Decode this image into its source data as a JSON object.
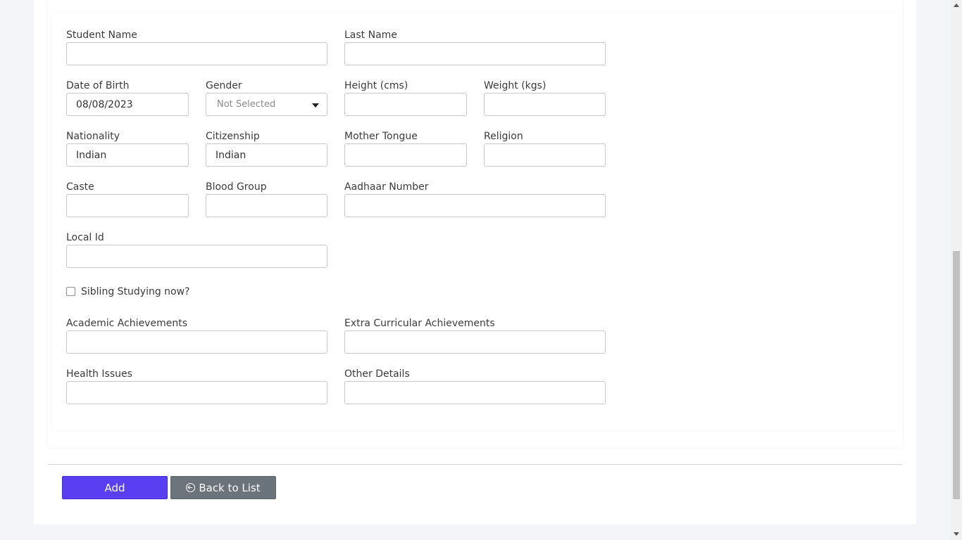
{
  "form": {
    "student_name": {
      "label": "Student Name",
      "value": ""
    },
    "last_name": {
      "label": "Last Name",
      "value": ""
    },
    "date_of_birth": {
      "label": "Date of Birth",
      "value": "08/08/2023"
    },
    "gender": {
      "label": "Gender",
      "selected": "Not Selected"
    },
    "height": {
      "label": "Height (cms)",
      "value": ""
    },
    "weight": {
      "label": "Weight (kgs)",
      "value": ""
    },
    "nationality": {
      "label": "Nationality",
      "value": "Indian"
    },
    "citizenship": {
      "label": "Citizenship",
      "value": "Indian"
    },
    "mother_tongue": {
      "label": "Mother Tongue",
      "value": ""
    },
    "religion": {
      "label": "Religion",
      "value": ""
    },
    "caste": {
      "label": "Caste",
      "value": ""
    },
    "blood_group": {
      "label": "Blood Group",
      "value": ""
    },
    "aadhaar_number": {
      "label": "Aadhaar Number",
      "value": ""
    },
    "local_id": {
      "label": "Local Id",
      "value": ""
    },
    "sibling_studying": {
      "label": "Sibling Studying now?",
      "checked": false
    },
    "academic_achievements": {
      "label": "Academic Achievements",
      "value": ""
    },
    "extra_curricular": {
      "label": "Extra Curricular Achievements",
      "value": ""
    },
    "health_issues": {
      "label": "Health Issues",
      "value": ""
    },
    "other_details": {
      "label": "Other Details",
      "value": ""
    }
  },
  "actions": {
    "add_label": "Add",
    "back_label": "Back to List"
  },
  "icons": {
    "back": "circle-arrow-left-icon",
    "dropdown": "caret-down-icon"
  },
  "colors": {
    "primary": "#5a3ff2",
    "secondary": "#6b737b",
    "background": "#f3f5f9"
  }
}
